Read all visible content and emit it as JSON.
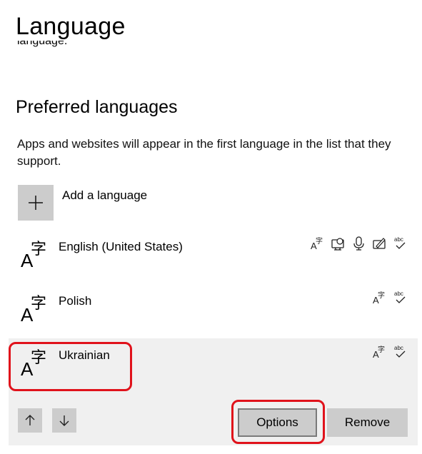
{
  "page": {
    "title": "Language",
    "truncated_text": "language.",
    "section_heading": "Preferred languages",
    "description": "Apps and websites will appear in the first language in the list that they support."
  },
  "add_language": {
    "label": "Add a language",
    "icon": "plus-icon"
  },
  "languages": [
    {
      "name": "English (United States)",
      "icon": "language-glyph-icon",
      "features": [
        "display-language-icon",
        "speech-icon",
        "voice-recognition-icon",
        "handwriting-icon",
        "spelling-icon"
      ]
    },
    {
      "name": "Polish",
      "icon": "language-glyph-icon",
      "features": [
        "display-language-icon",
        "spelling-icon"
      ]
    },
    {
      "name": "Ukrainian",
      "icon": "language-glyph-icon",
      "selected": true,
      "features": [
        "display-language-icon",
        "spelling-icon"
      ]
    }
  ],
  "buttons": {
    "move_up_icon": "arrow-up-icon",
    "move_down_icon": "arrow-down-icon",
    "options": "Options",
    "remove": "Remove"
  },
  "colors": {
    "annotation": "#e0121b",
    "selected_row": "#f0f0f0",
    "button": "#cccccc"
  }
}
